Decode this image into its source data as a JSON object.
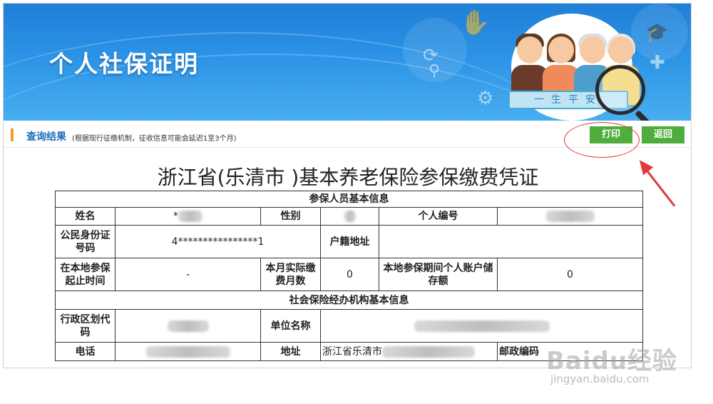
{
  "banner": {
    "title": "个人社保证明",
    "ribbon_text": "一生平安"
  },
  "query_bar": {
    "title": "查询结果",
    "note": "(根据现行征缴机制，征收信息可能会延迟1至3个月)",
    "print_label": "打印",
    "back_label": "返回"
  },
  "document": {
    "title": "浙江省(乐清市 )基本养老保险参保缴费凭证",
    "section1": "参保人员基本信息",
    "name_label": "姓名",
    "name_value": "*",
    "gender_label": "性别",
    "personal_id_label": "个人编号",
    "idcard_label": "公民身份证号码",
    "idcard_value": "4****************1",
    "household_label": "户籍地址",
    "period_label": "在本地参保起止时间",
    "period_value": "-",
    "months_label": "本月实际缴费月数",
    "months_value": "0",
    "account_label": "本地参保期间个人账户储存额",
    "account_value": "0",
    "section2": "社会保险经办机构基本信息",
    "region_label": "行政区划代码",
    "unit_label": "单位名称",
    "phone_label": "电话",
    "address_label": "地址",
    "address_value": "浙江省乐清市",
    "postcode_label": "邮政编码"
  },
  "watermark": {
    "main": "Baidu经验",
    "sub": "jingyan.baidu.com"
  },
  "colors": {
    "banner_blue": "#2c93e6",
    "button_green": "#4fad3e",
    "annotation_red": "#e0393a",
    "title_blue": "#1d6fb8"
  }
}
